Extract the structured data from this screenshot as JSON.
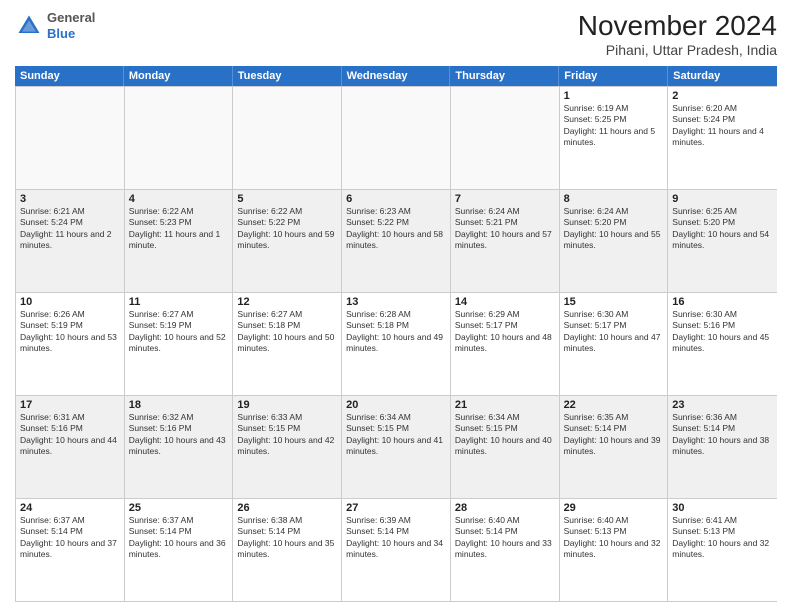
{
  "logo": {
    "general": "General",
    "blue": "Blue"
  },
  "title": "November 2024",
  "subtitle": "Pihani, Uttar Pradesh, India",
  "days_of_week": [
    "Sunday",
    "Monday",
    "Tuesday",
    "Wednesday",
    "Thursday",
    "Friday",
    "Saturday"
  ],
  "weeks": [
    [
      {
        "day": "",
        "empty": true
      },
      {
        "day": "",
        "empty": true
      },
      {
        "day": "",
        "empty": true
      },
      {
        "day": "",
        "empty": true
      },
      {
        "day": "",
        "empty": true
      },
      {
        "day": "1",
        "sunrise": "Sunrise: 6:19 AM",
        "sunset": "Sunset: 5:25 PM",
        "daylight": "Daylight: 11 hours and 5 minutes."
      },
      {
        "day": "2",
        "sunrise": "Sunrise: 6:20 AM",
        "sunset": "Sunset: 5:24 PM",
        "daylight": "Daylight: 11 hours and 4 minutes."
      }
    ],
    [
      {
        "day": "3",
        "sunrise": "Sunrise: 6:21 AM",
        "sunset": "Sunset: 5:24 PM",
        "daylight": "Daylight: 11 hours and 2 minutes."
      },
      {
        "day": "4",
        "sunrise": "Sunrise: 6:22 AM",
        "sunset": "Sunset: 5:23 PM",
        "daylight": "Daylight: 11 hours and 1 minute."
      },
      {
        "day": "5",
        "sunrise": "Sunrise: 6:22 AM",
        "sunset": "Sunset: 5:22 PM",
        "daylight": "Daylight: 10 hours and 59 minutes."
      },
      {
        "day": "6",
        "sunrise": "Sunrise: 6:23 AM",
        "sunset": "Sunset: 5:22 PM",
        "daylight": "Daylight: 10 hours and 58 minutes."
      },
      {
        "day": "7",
        "sunrise": "Sunrise: 6:24 AM",
        "sunset": "Sunset: 5:21 PM",
        "daylight": "Daylight: 10 hours and 57 minutes."
      },
      {
        "day": "8",
        "sunrise": "Sunrise: 6:24 AM",
        "sunset": "Sunset: 5:20 PM",
        "daylight": "Daylight: 10 hours and 55 minutes."
      },
      {
        "day": "9",
        "sunrise": "Sunrise: 6:25 AM",
        "sunset": "Sunset: 5:20 PM",
        "daylight": "Daylight: 10 hours and 54 minutes."
      }
    ],
    [
      {
        "day": "10",
        "sunrise": "Sunrise: 6:26 AM",
        "sunset": "Sunset: 5:19 PM",
        "daylight": "Daylight: 10 hours and 53 minutes."
      },
      {
        "day": "11",
        "sunrise": "Sunrise: 6:27 AM",
        "sunset": "Sunset: 5:19 PM",
        "daylight": "Daylight: 10 hours and 52 minutes."
      },
      {
        "day": "12",
        "sunrise": "Sunrise: 6:27 AM",
        "sunset": "Sunset: 5:18 PM",
        "daylight": "Daylight: 10 hours and 50 minutes."
      },
      {
        "day": "13",
        "sunrise": "Sunrise: 6:28 AM",
        "sunset": "Sunset: 5:18 PM",
        "daylight": "Daylight: 10 hours and 49 minutes."
      },
      {
        "day": "14",
        "sunrise": "Sunrise: 6:29 AM",
        "sunset": "Sunset: 5:17 PM",
        "daylight": "Daylight: 10 hours and 48 minutes."
      },
      {
        "day": "15",
        "sunrise": "Sunrise: 6:30 AM",
        "sunset": "Sunset: 5:17 PM",
        "daylight": "Daylight: 10 hours and 47 minutes."
      },
      {
        "day": "16",
        "sunrise": "Sunrise: 6:30 AM",
        "sunset": "Sunset: 5:16 PM",
        "daylight": "Daylight: 10 hours and 45 minutes."
      }
    ],
    [
      {
        "day": "17",
        "sunrise": "Sunrise: 6:31 AM",
        "sunset": "Sunset: 5:16 PM",
        "daylight": "Daylight: 10 hours and 44 minutes."
      },
      {
        "day": "18",
        "sunrise": "Sunrise: 6:32 AM",
        "sunset": "Sunset: 5:16 PM",
        "daylight": "Daylight: 10 hours and 43 minutes."
      },
      {
        "day": "19",
        "sunrise": "Sunrise: 6:33 AM",
        "sunset": "Sunset: 5:15 PM",
        "daylight": "Daylight: 10 hours and 42 minutes."
      },
      {
        "day": "20",
        "sunrise": "Sunrise: 6:34 AM",
        "sunset": "Sunset: 5:15 PM",
        "daylight": "Daylight: 10 hours and 41 minutes."
      },
      {
        "day": "21",
        "sunrise": "Sunrise: 6:34 AM",
        "sunset": "Sunset: 5:15 PM",
        "daylight": "Daylight: 10 hours and 40 minutes."
      },
      {
        "day": "22",
        "sunrise": "Sunrise: 6:35 AM",
        "sunset": "Sunset: 5:14 PM",
        "daylight": "Daylight: 10 hours and 39 minutes."
      },
      {
        "day": "23",
        "sunrise": "Sunrise: 6:36 AM",
        "sunset": "Sunset: 5:14 PM",
        "daylight": "Daylight: 10 hours and 38 minutes."
      }
    ],
    [
      {
        "day": "24",
        "sunrise": "Sunrise: 6:37 AM",
        "sunset": "Sunset: 5:14 PM",
        "daylight": "Daylight: 10 hours and 37 minutes."
      },
      {
        "day": "25",
        "sunrise": "Sunrise: 6:37 AM",
        "sunset": "Sunset: 5:14 PM",
        "daylight": "Daylight: 10 hours and 36 minutes."
      },
      {
        "day": "26",
        "sunrise": "Sunrise: 6:38 AM",
        "sunset": "Sunset: 5:14 PM",
        "daylight": "Daylight: 10 hours and 35 minutes."
      },
      {
        "day": "27",
        "sunrise": "Sunrise: 6:39 AM",
        "sunset": "Sunset: 5:14 PM",
        "daylight": "Daylight: 10 hours and 34 minutes."
      },
      {
        "day": "28",
        "sunrise": "Sunrise: 6:40 AM",
        "sunset": "Sunset: 5:14 PM",
        "daylight": "Daylight: 10 hours and 33 minutes."
      },
      {
        "day": "29",
        "sunrise": "Sunrise: 6:40 AM",
        "sunset": "Sunset: 5:13 PM",
        "daylight": "Daylight: 10 hours and 32 minutes."
      },
      {
        "day": "30",
        "sunrise": "Sunrise: 6:41 AM",
        "sunset": "Sunset: 5:13 PM",
        "daylight": "Daylight: 10 hours and 32 minutes."
      }
    ]
  ]
}
